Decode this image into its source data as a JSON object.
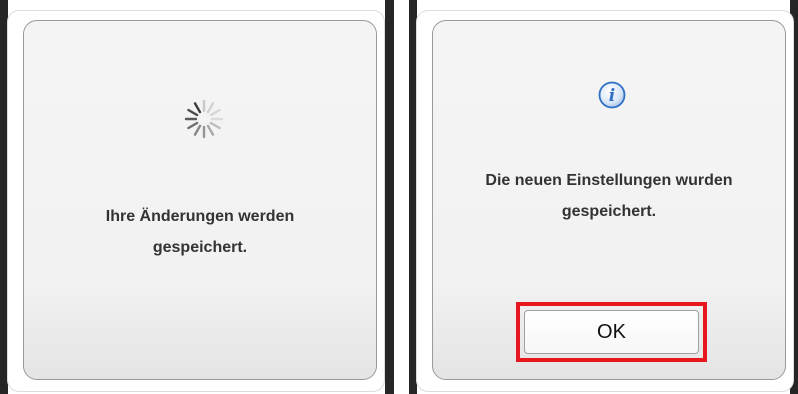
{
  "left_dialog": {
    "status_icon": "loading-spinner-icon",
    "message_line1": "Ihre Änderungen werden",
    "message_line2": "gespeichert."
  },
  "right_dialog": {
    "status_icon": "info-icon",
    "message_line1": "Die neuen Einstellungen wurden",
    "message_line2": "gespeichert.",
    "ok_button_label": "OK",
    "highlight_color": "#e8161e",
    "info_icon_color": "#2f6fc4"
  }
}
